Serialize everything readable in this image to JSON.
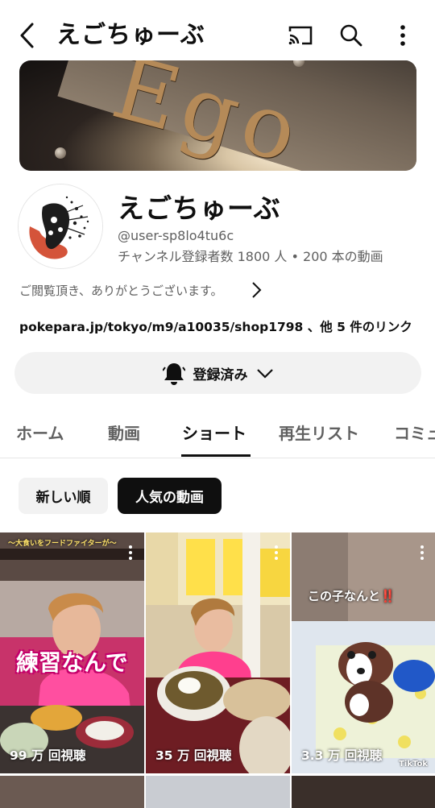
{
  "header": {
    "title": "えごちゅーぶ",
    "icons": [
      "back-arrow-icon",
      "cast-icon",
      "search-icon",
      "more-vert-icon"
    ]
  },
  "banner": {
    "text": "Ego"
  },
  "channel": {
    "name": "えごちゅーぶ",
    "handle": "@user-sp8lo4tu6c",
    "stats": "チャンネル登録者数 1800 人 • 200 本の動画",
    "description": "ご閲覧頂き、ありがとうございます。",
    "link": "pokepara.jp/tokyo/m9/a10035/shop1798 、他 5 件のリンク"
  },
  "subscribe": {
    "label": "登録済み",
    "icon": "bell-icon"
  },
  "tabs": [
    {
      "label": "ホーム"
    },
    {
      "label": "動画"
    },
    {
      "label": "ショート"
    },
    {
      "label": "再生リスト"
    },
    {
      "label": "コミュ"
    }
  ],
  "active_tab": "ショート",
  "chips": [
    {
      "label": "新しい順",
      "selected": false
    },
    {
      "label": "人気の動画",
      "selected": true
    }
  ],
  "shorts": [
    {
      "views": "99 万 回視聴",
      "overlay": "練習なんで",
      "top_caption": "〜大食いをフードファイターが〜"
    },
    {
      "views": "35 万 回視聴",
      "overlay": "",
      "top_caption": ""
    },
    {
      "views": "3.3 万 回視聴",
      "overlay": "この子",
      "overlay_suffix": "なんと‼️",
      "watermark": "TikTok"
    }
  ],
  "colors": {
    "text_primary": "#0f0f0f",
    "text_secondary": "#606060",
    "chip_selected_bg": "#0f0f0f",
    "chip_bg": "#f2f2f2"
  }
}
